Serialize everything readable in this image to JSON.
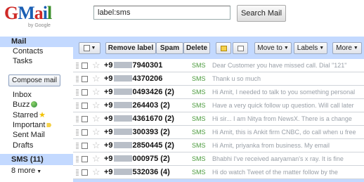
{
  "logo": {
    "byline": "by Google"
  },
  "search": {
    "query": "label:sms",
    "button_label": "Search Mail"
  },
  "nav": {
    "mail": "Mail",
    "contacts": "Contacts",
    "tasks": "Tasks",
    "compose": "Compose mail",
    "inbox": "Inbox",
    "buzz": "Buzz",
    "starred": "Starred",
    "important": "Important",
    "sent": "Sent Mail",
    "drafts": "Drafts",
    "sms": "SMS (11)",
    "more": "8 more"
  },
  "toolbar": {
    "remove_label": "Remove label",
    "spam": "Spam",
    "delete": "Delete",
    "move_to": "Move to",
    "labels": "Labels",
    "more": "More"
  },
  "rows": [
    {
      "sender_prefix": "+9",
      "sender_suffix": "7940301",
      "tag": "SMS",
      "snippet": "Dear Customer you have missed call. Dial \"121\""
    },
    {
      "sender_prefix": "+9",
      "sender_suffix": "4370206",
      "tag": "SMS",
      "snippet": "Thank u so much"
    },
    {
      "sender_prefix": "+9",
      "sender_suffix": "0493426 (2)",
      "tag": "SMS",
      "snippet": "Hi Amit, I needed to talk to you something personal"
    },
    {
      "sender_prefix": "+9",
      "sender_suffix": "264403 (2)",
      "tag": "SMS",
      "snippet": "Have a very quick follow up question. Will call later"
    },
    {
      "sender_prefix": "+9",
      "sender_suffix": "4361670 (2)",
      "tag": "SMS",
      "snippet": "Hi sir... I am Nitya from NewsX. There is a change"
    },
    {
      "sender_prefix": "+9",
      "sender_suffix": "300393 (2)",
      "tag": "SMS",
      "snippet": "Hi Amit, this is Ankit firm CNBC, do call when u free"
    },
    {
      "sender_prefix": "+9",
      "sender_suffix": "2850445 (2)",
      "tag": "SMS",
      "snippet": "Hi Amit, priyanka from business. My email"
    },
    {
      "sender_prefix": "+9",
      "sender_suffix": "000975 (2)",
      "tag": "SMS",
      "snippet": "Bhabhi I've received aaryaman's x ray. It is fine"
    },
    {
      "sender_prefix": "+9",
      "sender_suffix": "532036 (4)",
      "tag": "SMS",
      "snippet": "Hi do watch Tweet of the matter follow by the"
    }
  ]
}
